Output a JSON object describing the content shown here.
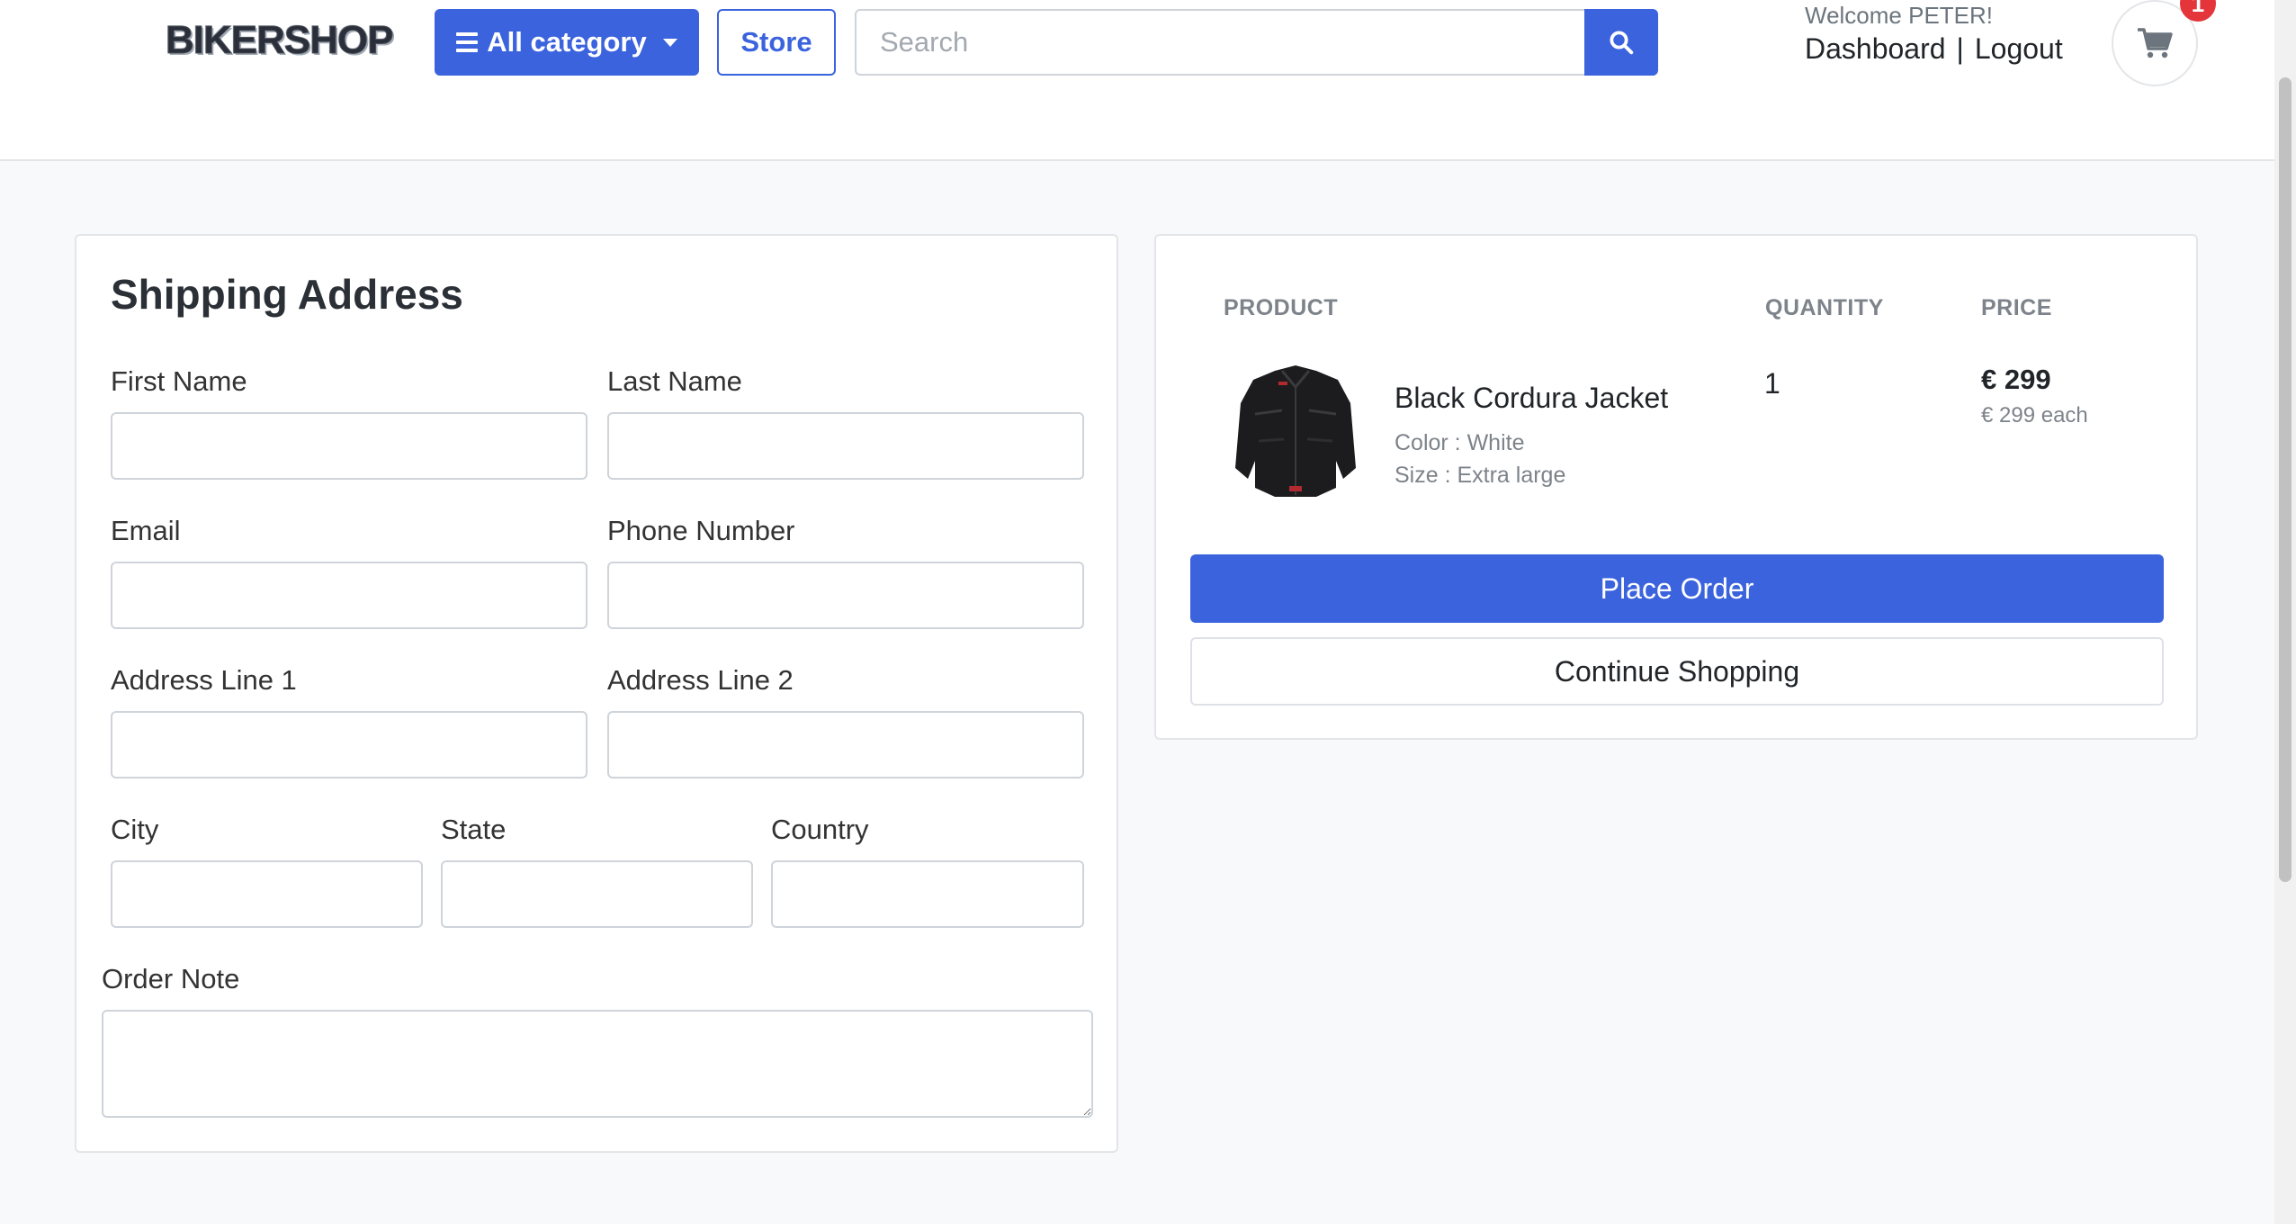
{
  "header": {
    "logo_text": "BIKERSHOP",
    "category_button": "All category",
    "store_button": "Store",
    "search_placeholder": "Search",
    "welcome_text": "Welcome PETER!",
    "dashboard_link": "Dashboard",
    "separator": "|",
    "logout_link": "Logout",
    "cart_count": "1"
  },
  "shipping": {
    "title": "Shipping Address",
    "fields": {
      "first_name": "First Name",
      "last_name": "Last Name",
      "email": "Email",
      "phone": "Phone Number",
      "address1": "Address Line 1",
      "address2": "Address Line 2",
      "city": "City",
      "state": "State",
      "country": "Country",
      "order_note": "Order Note"
    }
  },
  "order": {
    "columns": {
      "product": "PRODUCT",
      "quantity": "QUANTITY",
      "price": "PRICE"
    },
    "item": {
      "name": "Black Cordura Jacket",
      "color": "Color : White",
      "size": "Size : Extra large",
      "quantity": "1",
      "price": "€ 299",
      "price_each": "€ 299 each"
    },
    "place_order_button": "Place Order",
    "continue_button": "Continue Shopping"
  },
  "colors": {
    "primary": "#3b63dd",
    "badge": "#e4353a",
    "background": "#f8f9fb"
  }
}
